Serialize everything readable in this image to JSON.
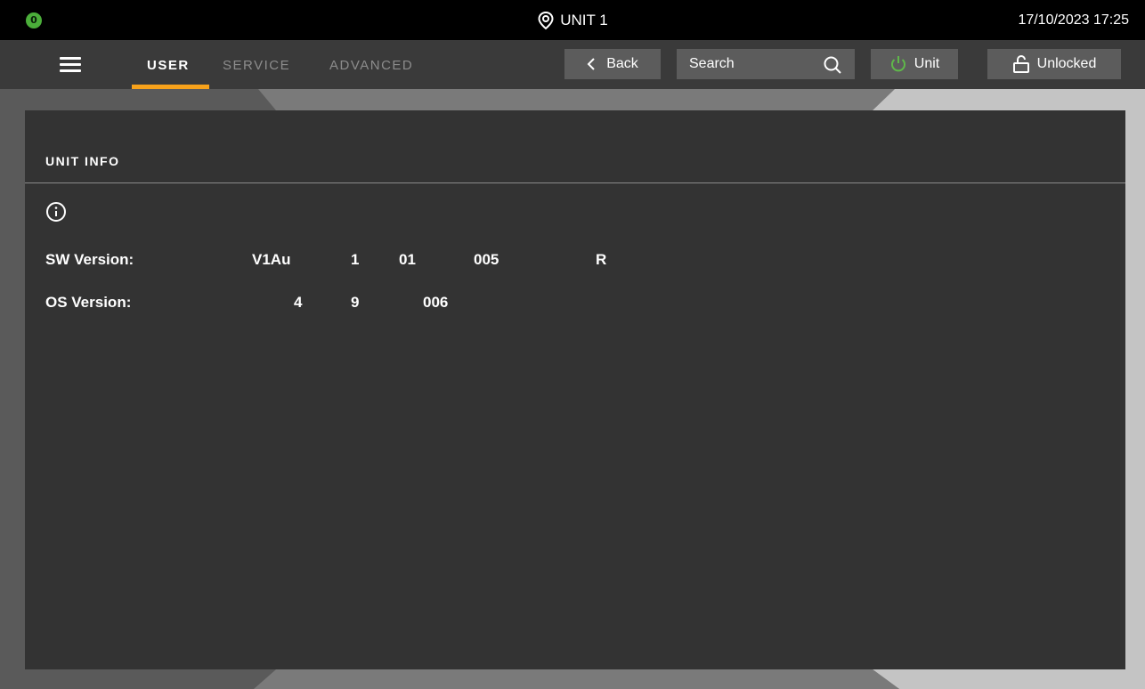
{
  "topbar": {
    "alarm_count": "0",
    "location": "UNIT 1",
    "datetime": "17/10/2023 17:25"
  },
  "nav": {
    "tabs": [
      {
        "label": "USER",
        "active": true
      },
      {
        "label": "SERVICE",
        "active": false
      },
      {
        "label": "ADVANCED",
        "active": false
      }
    ],
    "back_label": "Back",
    "search_placeholder": "Search",
    "unit_label": "Unit",
    "lock_label": "Unlocked",
    "icons": [
      "menu-icon",
      "chevron-left-icon",
      "search-icon",
      "power-icon",
      "unlock-icon",
      "location-pin-icon"
    ]
  },
  "colors": {
    "accent": "#f7a21b",
    "badge": "#4bae3a",
    "power": "#5fb84a"
  },
  "panel": {
    "title": "UNIT INFO",
    "info_icon": "info-icon",
    "rows": [
      {
        "label": "SW Version:",
        "values": [
          "V1Au",
          "1",
          "01",
          "005",
          "R"
        ]
      },
      {
        "label": "OS Version:",
        "values": [
          "4",
          "9",
          "006"
        ]
      }
    ]
  }
}
